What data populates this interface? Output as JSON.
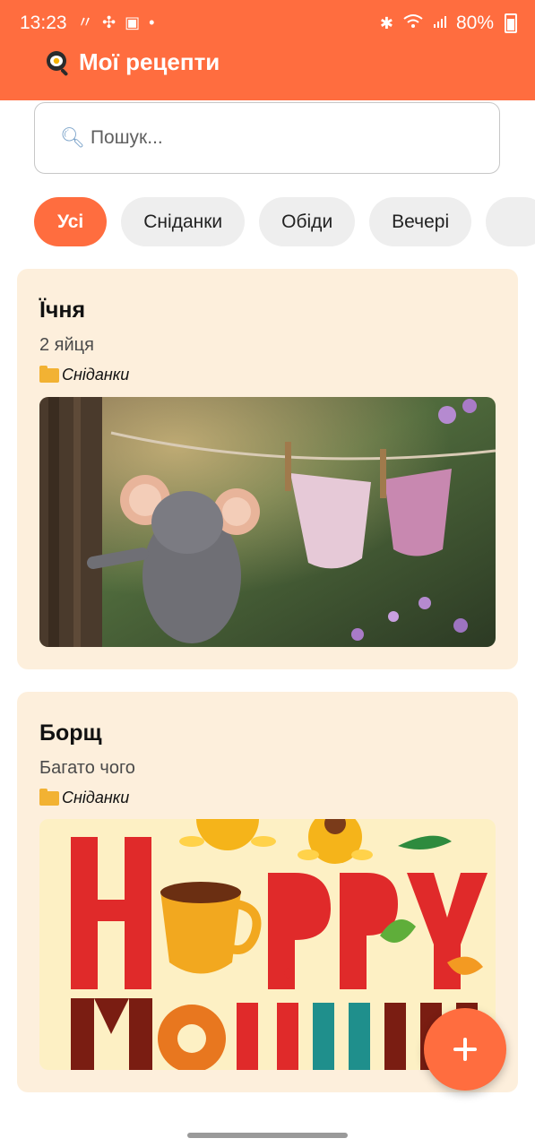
{
  "status_bar": {
    "time": "13:23",
    "battery": "80%"
  },
  "app_bar": {
    "title": "Мої рецепти",
    "icon": "frying-pan-icon"
  },
  "search": {
    "placeholder": "Пошук..."
  },
  "categories": [
    {
      "label": "Усі",
      "selected": true
    },
    {
      "label": "Сніданки",
      "selected": false
    },
    {
      "label": "Обіди",
      "selected": false
    },
    {
      "label": "Вечері",
      "selected": false
    }
  ],
  "recipes": [
    {
      "title": "Їчня",
      "description": "2 яйця",
      "category": "Сніданки",
      "image": "mouse-clothesline-photo"
    },
    {
      "title": "Борщ",
      "description": "Багато чого",
      "category": "Сніданки",
      "image": "happy-morning-illustration"
    }
  ],
  "fab": {
    "icon": "plus-icon"
  },
  "colors": {
    "accent": "#ff6d3f",
    "card_bg": "#fdefdc",
    "chip_bg": "#eeeeee"
  }
}
